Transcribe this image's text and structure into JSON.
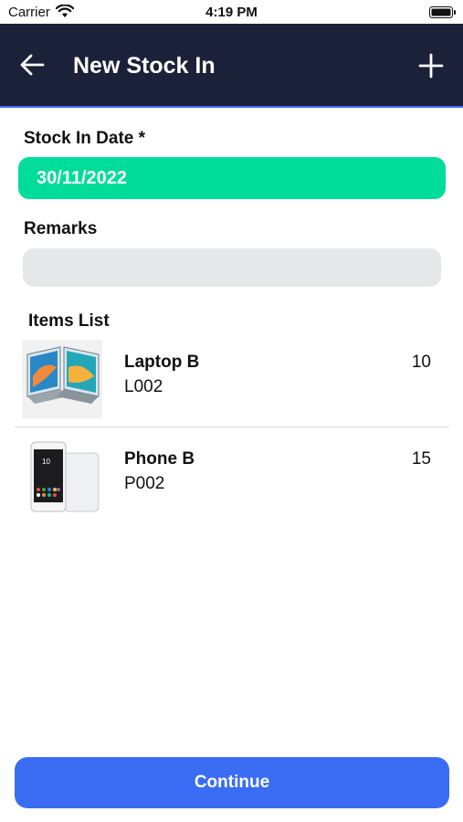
{
  "status_bar": {
    "carrier": "Carrier",
    "time": "4:19 PM"
  },
  "header": {
    "title": "New Stock In",
    "back_icon": "arrow-left-icon",
    "add_icon": "plus-icon",
    "background_color": "#1a2138"
  },
  "form": {
    "date_label": "Stock In Date *",
    "date_value": "30/11/2022",
    "date_color": "#00dc9a",
    "remarks_label": "Remarks",
    "remarks_value": ""
  },
  "items": {
    "label": "Items List",
    "list": [
      {
        "name": "Laptop B",
        "code": "L002",
        "quantity": "10",
        "image": "laptop-image"
      },
      {
        "name": "Phone B",
        "code": "P002",
        "quantity": "15",
        "image": "phone-image"
      }
    ]
  },
  "footer": {
    "continue_label": "Continue",
    "button_color": "#3a6cf4"
  }
}
